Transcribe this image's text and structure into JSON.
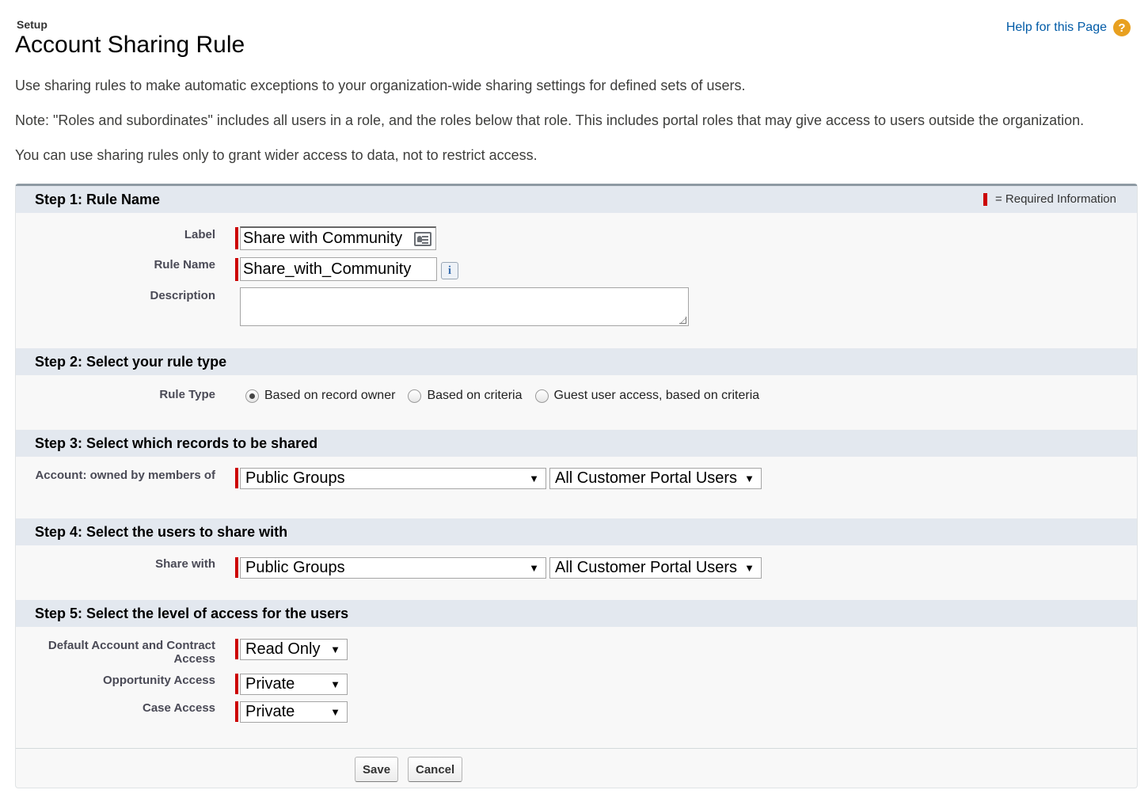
{
  "header": {
    "eyebrow": "Setup",
    "title": "Account Sharing Rule",
    "help_link": "Help for this Page",
    "help_icon": "?"
  },
  "intro": {
    "p1": "Use sharing rules to make automatic exceptions to your organization-wide sharing settings for defined sets of users.",
    "p2": "Note: \"Roles and subordinates\" includes all users in a role, and the roles below that role. This includes portal roles that may give access to users outside the organization.",
    "p3": "You can use sharing rules only to grant wider access to data, not to restrict access."
  },
  "required_legend": "= Required Information",
  "step1": {
    "title": "Step 1: Rule Name",
    "label_label": "Label",
    "label_value": "Share with Community",
    "rule_name_label": "Rule Name",
    "rule_name_value": "Share_with_Community",
    "rule_name_info": "i",
    "description_label": "Description",
    "description_value": ""
  },
  "step2": {
    "title": "Step 2: Select your rule type",
    "rule_type_label": "Rule Type",
    "options": [
      "Based on record owner",
      "Based on criteria",
      "Guest user access, based on criteria"
    ],
    "selected": "Based on record owner"
  },
  "step3": {
    "title": "Step 3: Select which records to be shared",
    "owned_by_label": "Account: owned by members of",
    "group_type": "Public Groups",
    "group_value": "All Customer Portal Users"
  },
  "step4": {
    "title": "Step 4: Select the users to share with",
    "share_with_label": "Share with",
    "group_type": "Public Groups",
    "group_value": "All Customer Portal Users"
  },
  "step5": {
    "title": "Step 5: Select the level of access for the users",
    "account_access_label": "Default Account and Contract Access",
    "account_access_value": "Read Only",
    "opportunity_access_label": "Opportunity Access",
    "opportunity_access_value": "Private",
    "case_access_label": "Case Access",
    "case_access_value": "Private"
  },
  "buttons": {
    "save": "Save",
    "cancel": "Cancel"
  },
  "colors": {
    "required": "#cc0000",
    "section_header": "#e3e8ef",
    "link": "#015ba7",
    "help_icon": "#e8a020"
  }
}
